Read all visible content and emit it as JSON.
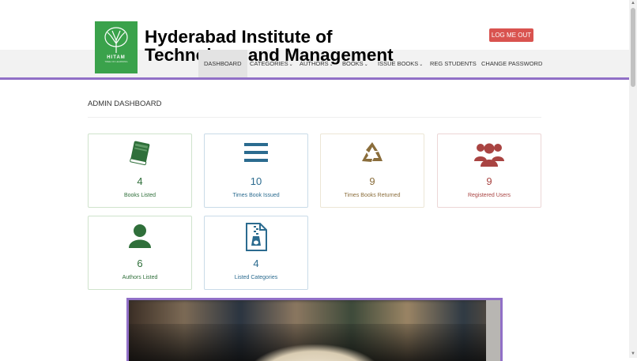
{
  "header": {
    "title": "Hyderabad Institute of Technology and Management",
    "logo": {
      "text": "HITAM",
      "subtext": "TREE OF LEARNING"
    },
    "logout_label": "LOG ME OUT"
  },
  "nav": {
    "items": [
      {
        "label": "DASHBOARD",
        "dropdown": false,
        "active": true
      },
      {
        "label": "CATEGORIES",
        "dropdown": true
      },
      {
        "label": "AUTHORS",
        "dropdown": true
      },
      {
        "label": "BOOKS",
        "dropdown": true
      },
      {
        "label": "ISSUE BOOKS",
        "dropdown": true
      },
      {
        "label": "REG STUDENTS",
        "dropdown": false
      },
      {
        "label": "CHANGE PASSWORD",
        "dropdown": false
      }
    ],
    "caret": "⌄"
  },
  "page": {
    "heading": "ADMIN DASHBOARD"
  },
  "cards": [
    {
      "icon": "book-icon",
      "value": "4",
      "label": "Books Listed",
      "color": "#2f6f3a"
    },
    {
      "icon": "list-icon",
      "value": "10",
      "label": "Times Book Issued",
      "color": "#2b6b8f"
    },
    {
      "icon": "recycle-icon",
      "value": "9",
      "label": "Times Books Returned",
      "color": "#8a6d3b"
    },
    {
      "icon": "users-icon",
      "value": "9",
      "label": "Registered Users",
      "color": "#a94442"
    },
    {
      "icon": "user-icon",
      "value": "6",
      "label": "Authors Listed",
      "color": "#2f6f3a"
    },
    {
      "icon": "file-zip-icon",
      "value": "4",
      "label": "Listed Categories",
      "color": "#2b6b8f"
    }
  ],
  "colors": {
    "accent": "#9170c7",
    "logout": "#d9534f",
    "logo_bg": "#3aa24b"
  }
}
